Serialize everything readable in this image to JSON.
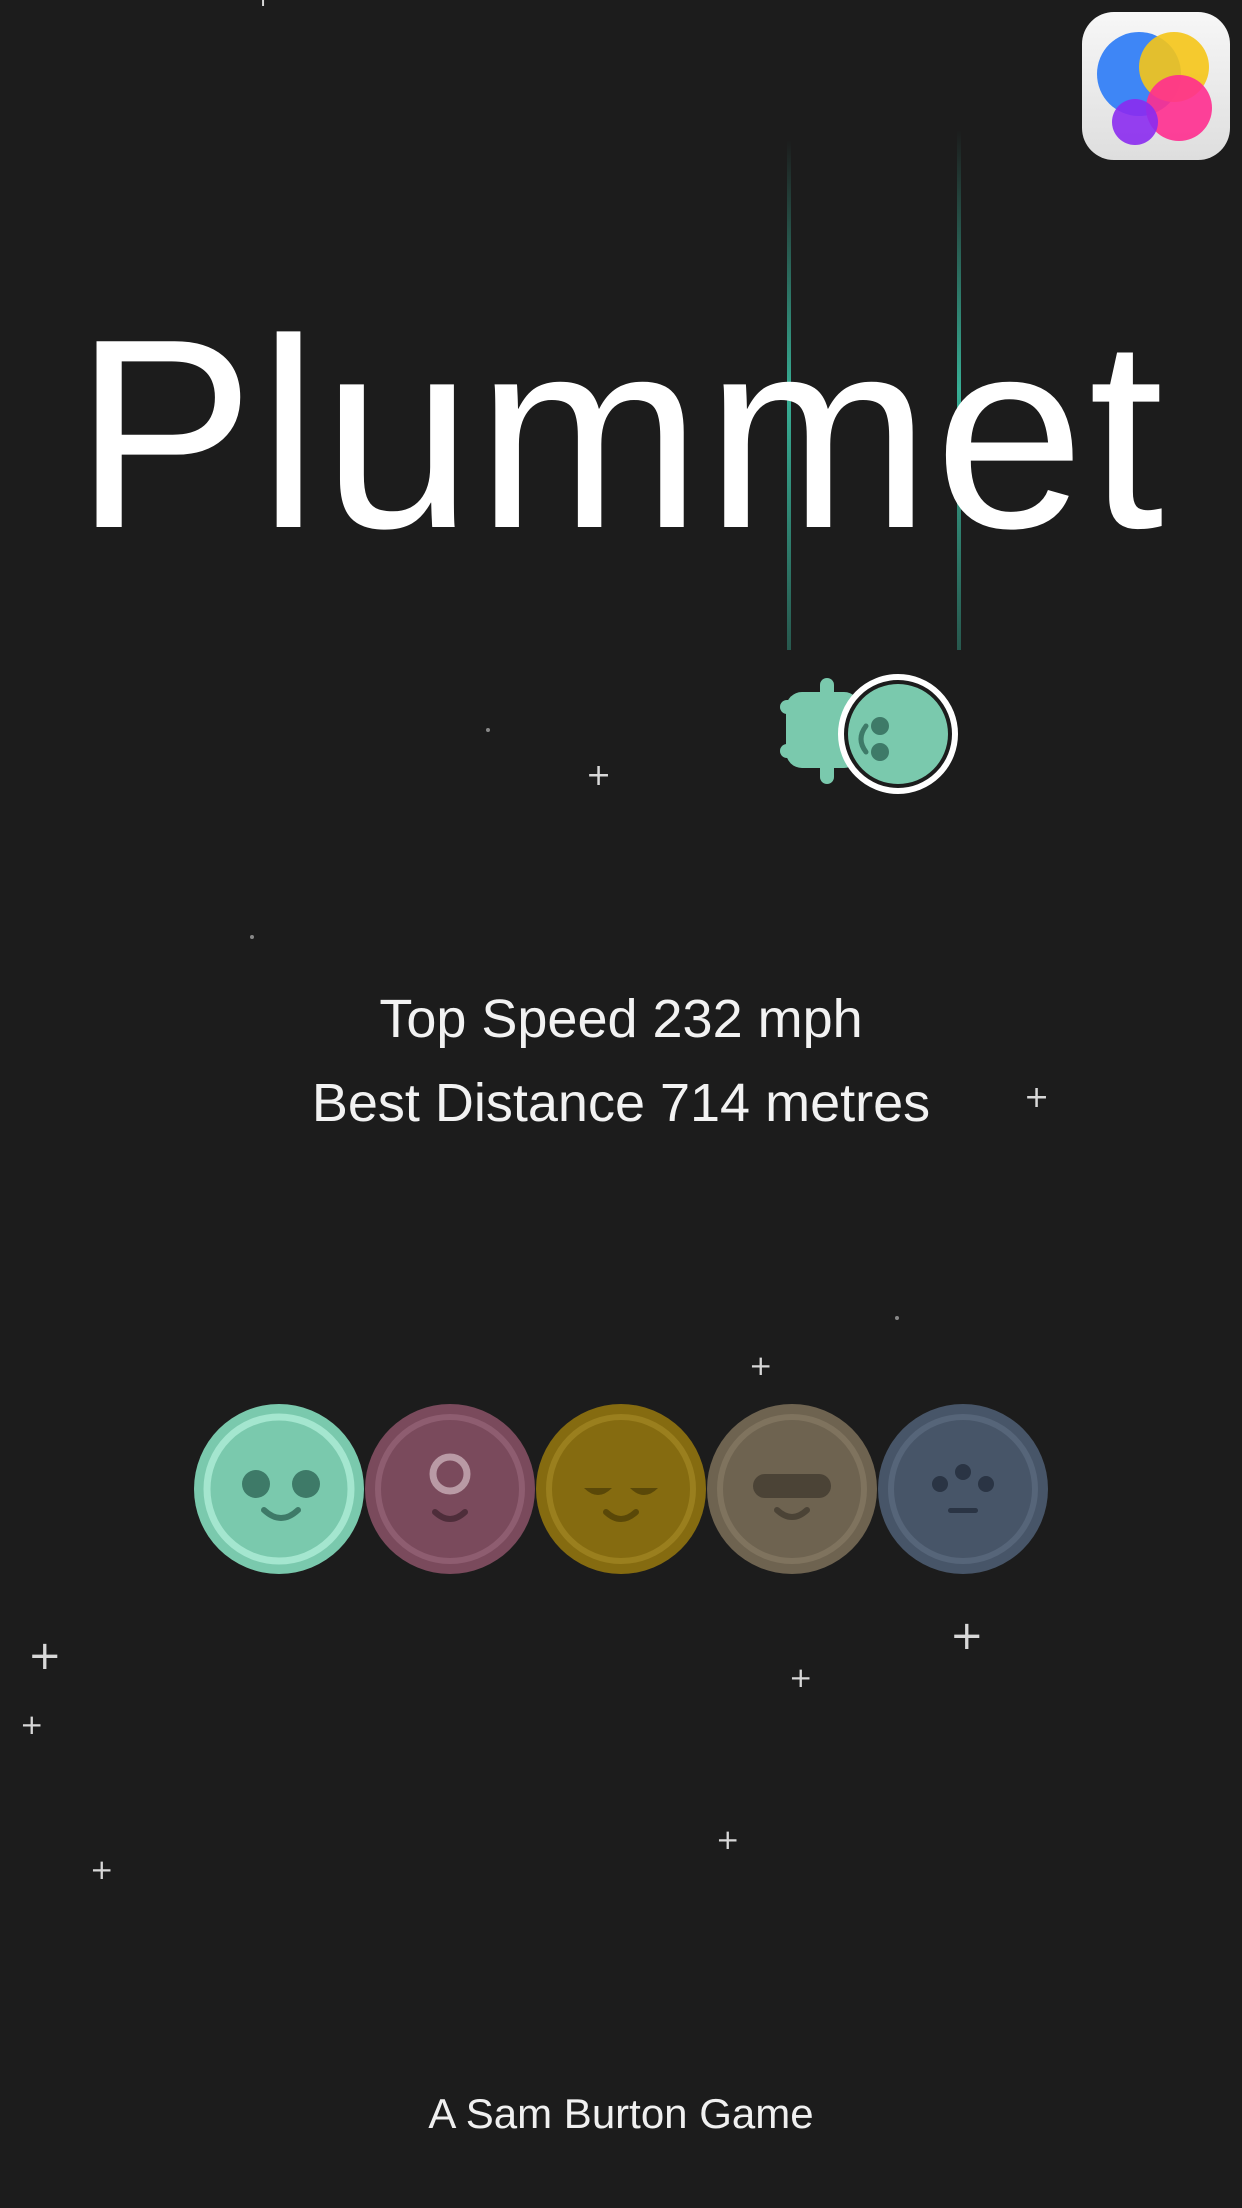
{
  "game": {
    "title": "Plummet",
    "credit": "A Sam Burton Game"
  },
  "stats": {
    "top_speed": "Top Speed 232 mph",
    "best_distance": "Best Distance 714 metres"
  },
  "game_center": {
    "icon": "game-center-icon",
    "colors": [
      "#2f7df6",
      "#f5c518",
      "#ff2d8f",
      "#8b2bf0"
    ]
  },
  "characters": [
    {
      "name": "green",
      "color": "#7ac9ad",
      "selected": true
    },
    {
      "name": "pink",
      "color": "#7a4a5c",
      "selected": false
    },
    {
      "name": "yellow",
      "color": "#856b10",
      "selected": false
    },
    {
      "name": "tan",
      "color": "#6e6350",
      "selected": false
    },
    {
      "name": "blue",
      "color": "#475568",
      "selected": false
    }
  ],
  "colors": {
    "background": "#1c1c1c",
    "accent": "#7ac9ad",
    "trail": "#3cc8aa"
  }
}
